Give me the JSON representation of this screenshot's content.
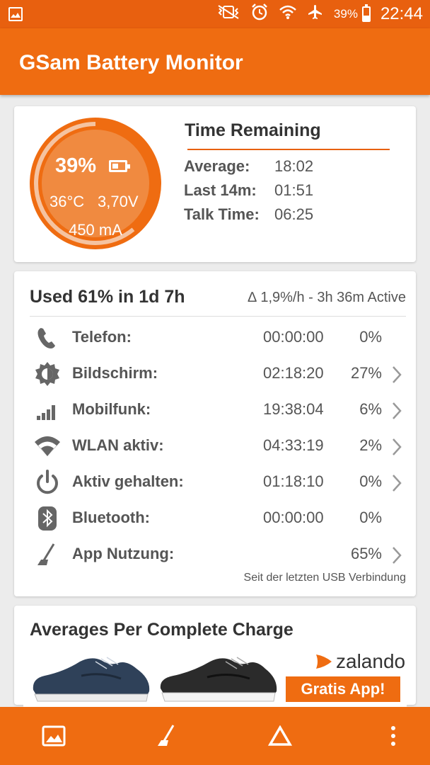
{
  "status_bar": {
    "battery_percent": "39%",
    "battery_level": 0.39,
    "time": "22:44",
    "icons": [
      "image-icon",
      "vibrate-off-icon",
      "alarm-icon",
      "wifi-icon",
      "airplane-icon",
      "battery-icon"
    ]
  },
  "app": {
    "title": "GSam Battery Monitor"
  },
  "gauge": {
    "percent": "39%",
    "level": 0.39,
    "temperature": "36°C",
    "voltage": "3,70V",
    "current": "450 mA"
  },
  "time_remaining": {
    "title": "Time Remaining",
    "rows": [
      {
        "label": "Average:",
        "value": "18:02"
      },
      {
        "label": "Last 14m:",
        "value": "01:51"
      },
      {
        "label": "Talk Time:",
        "value": "06:25"
      }
    ]
  },
  "usage": {
    "title": "Used 61% in 1d 7h",
    "rate": "∆ 1,9%/h - 3h 36m Active",
    "rows": [
      {
        "icon": "phone-icon",
        "label": "Telefon:",
        "time": "00:00:00",
        "pct": "0%",
        "chevron": false
      },
      {
        "icon": "brightness-icon",
        "label": "Bildschirm:",
        "time": "02:18:20",
        "pct": "27%",
        "chevron": true
      },
      {
        "icon": "signal-bars-icon",
        "label": "Mobilfunk:",
        "time": "19:38:04",
        "pct": "6%",
        "chevron": true
      },
      {
        "icon": "wifi-icon",
        "label": "WLAN aktiv:",
        "time": "04:33:19",
        "pct": "2%",
        "chevron": true
      },
      {
        "icon": "power-icon",
        "label": "Aktiv gehalten:",
        "time": "01:18:10",
        "pct": "0%",
        "chevron": true
      },
      {
        "icon": "bluetooth-icon",
        "label": "Bluetooth:",
        "time": "00:00:00",
        "pct": "0%",
        "chevron": false
      },
      {
        "icon": "app-usage-icon",
        "label": "App Nutzung:",
        "time": "",
        "pct": "65%",
        "chevron": true
      }
    ],
    "footnote": "Seit der letzten USB Verbindung"
  },
  "averages": {
    "title": "Averages Per Complete Charge"
  },
  "ad": {
    "brand": "zalando",
    "button": "Gratis App!",
    "colors": {
      "shoe1": "#2f4159",
      "shoe2": "#2b2b2b",
      "brand": "#ef6c11"
    }
  },
  "bottom_bar": {
    "items": [
      "image-icon",
      "app-usage-icon",
      "delta-icon",
      "more-vert-icon"
    ]
  },
  "colors": {
    "primary": "#ef6c11",
    "status_bar": "#e8600f",
    "background": "#ececec"
  }
}
